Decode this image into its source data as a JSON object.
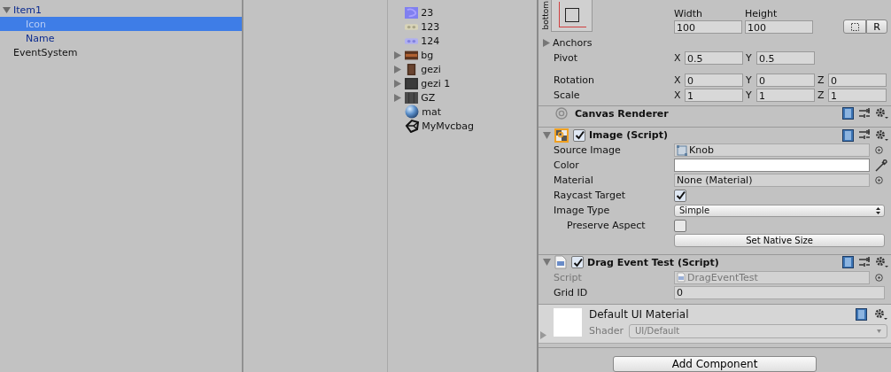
{
  "hierarchy": {
    "items": [
      {
        "label": "Item1",
        "prefab": true,
        "expanded": true,
        "selected": false,
        "children": [
          {
            "label": "Icon",
            "prefab": true,
            "selected": true
          },
          {
            "label": "Name",
            "prefab": true,
            "selected": false
          }
        ]
      },
      {
        "label": "EventSystem",
        "prefab": false,
        "selected": false
      }
    ]
  },
  "project": {
    "assets": [
      {
        "name": "23",
        "kind": "normal-map",
        "expandable": false
      },
      {
        "name": "123",
        "kind": "light-strip",
        "expandable": false
      },
      {
        "name": "124",
        "kind": "blue-strip",
        "expandable": false
      },
      {
        "name": "bg",
        "kind": "wide-texture",
        "expandable": true
      },
      {
        "name": "gezi",
        "kind": "brown-tile",
        "expandable": true
      },
      {
        "name": "gezi 1",
        "kind": "dark-tile",
        "expandable": true
      },
      {
        "name": "GZ",
        "kind": "dark-grid",
        "expandable": true
      },
      {
        "name": "mat",
        "kind": "material",
        "expandable": false
      },
      {
        "name": "MyMvcbag",
        "kind": "unity-scene",
        "expandable": false
      }
    ]
  },
  "inspector": {
    "rect_transform": {
      "anchor_label": "bottom",
      "size_fields": [
        {
          "label": "Width",
          "value": "100"
        },
        {
          "label": "Height",
          "value": "100"
        }
      ],
      "raw_button": "R",
      "anchors": {
        "label": "Anchors",
        "expanded": false
      },
      "vectors": [
        {
          "label": "Pivot",
          "fields": [
            {
              "axis": "X",
              "value": "0.5"
            },
            {
              "axis": "Y",
              "value": "0.5"
            }
          ]
        },
        {
          "label": "Rotation",
          "fields": [
            {
              "axis": "X",
              "value": "0"
            },
            {
              "axis": "Y",
              "value": "0"
            },
            {
              "axis": "Z",
              "value": "0"
            }
          ]
        },
        {
          "label": "Scale",
          "fields": [
            {
              "axis": "X",
              "value": "1"
            },
            {
              "axis": "Y",
              "value": "1"
            },
            {
              "axis": "Z",
              "value": "1"
            }
          ]
        }
      ]
    },
    "components": [
      {
        "title": "Canvas Renderer",
        "kind": "canvas-renderer",
        "foldout": false
      },
      {
        "title": "Image (Script)",
        "kind": "image",
        "foldout": true,
        "expanded": true,
        "enabled": true,
        "properties": [
          {
            "label": "Source Image",
            "kind": "sprite",
            "value": "Knob",
            "disabled": false
          },
          {
            "label": "Color",
            "kind": "color",
            "color": "#ffffff"
          },
          {
            "label": "Material",
            "kind": "object",
            "value": "None (Material)",
            "disabled": false
          },
          {
            "label": "Raycast Target",
            "kind": "checkbox",
            "checked": true,
            "indented": false
          },
          {
            "label": "Image Type",
            "kind": "dropdown",
            "value": "Simple"
          },
          {
            "label": "Preserve Aspect",
            "kind": "checkbox",
            "checked": false,
            "indented": true
          },
          {
            "kind": "button",
            "value": "Set Native Size"
          }
        ]
      },
      {
        "title": "Drag Event Test (Script)",
        "kind": "script",
        "foldout": true,
        "expanded": true,
        "enabled": true,
        "properties": [
          {
            "label": "Script",
            "kind": "script",
            "value": "DragEventTest",
            "disabled": true
          },
          {
            "label": "Grid ID",
            "kind": "text",
            "value": "0"
          }
        ]
      }
    ],
    "material": {
      "name": "Default UI Material",
      "shader_label": "Shader",
      "shader": "UI/Default"
    },
    "add_component": "Add Component"
  }
}
